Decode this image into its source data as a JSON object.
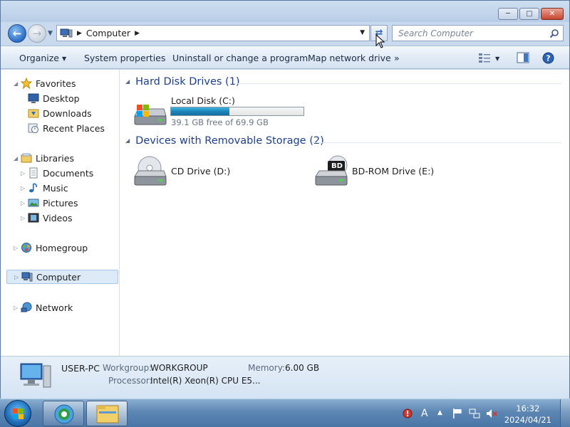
{
  "window": {
    "title_buttons": {
      "minimize": "minimize",
      "maximize": "maximize",
      "close": "close"
    }
  },
  "address": {
    "path": "Computer",
    "search_placeholder": "Search Computer"
  },
  "toolbar": {
    "organize": "Organize",
    "system_properties": "System properties",
    "uninstall": "Uninstall or change a program",
    "map_drive": "Map network drive",
    "more": "»"
  },
  "sidebar": {
    "favorites": "Favorites",
    "desktop": "Desktop",
    "downloads": "Downloads",
    "recent_places": "Recent Places",
    "libraries": "Libraries",
    "documents": "Documents",
    "music": "Music",
    "pictures": "Pictures",
    "videos": "Videos",
    "homegroup": "Homegroup",
    "computer": "Computer",
    "network": "Network"
  },
  "groups": {
    "hdd": {
      "header": "Hard Disk Drives (1)",
      "drives": [
        {
          "label": "Local Disk (C:)",
          "free": "39.1 GB free of 69.9 GB",
          "used_fraction": 0.44
        }
      ]
    },
    "removable": {
      "header": "Devices with Removable Storage (2)",
      "drives": [
        {
          "label": "CD Drive (D:)"
        },
        {
          "label": "BD-ROM Drive (E:)",
          "badge": "BD"
        }
      ]
    }
  },
  "details": {
    "computer_name": "USER-PC",
    "workgroup_key": "Workgroup:",
    "workgroup_val": "WORKGROUP",
    "memory_key": "Memory:",
    "memory_val": "6.00 GB",
    "processor_key": "Processor:",
    "processor_val": "Intel(R) Xeon(R) CPU E5..."
  },
  "taskbar": {
    "time": "16:32",
    "date": "2024/04/21",
    "lang": "A"
  },
  "colors": {
    "accent": "#1e3f87",
    "capacity_fill": "#1c84b9",
    "selection": "#dceaf8"
  }
}
